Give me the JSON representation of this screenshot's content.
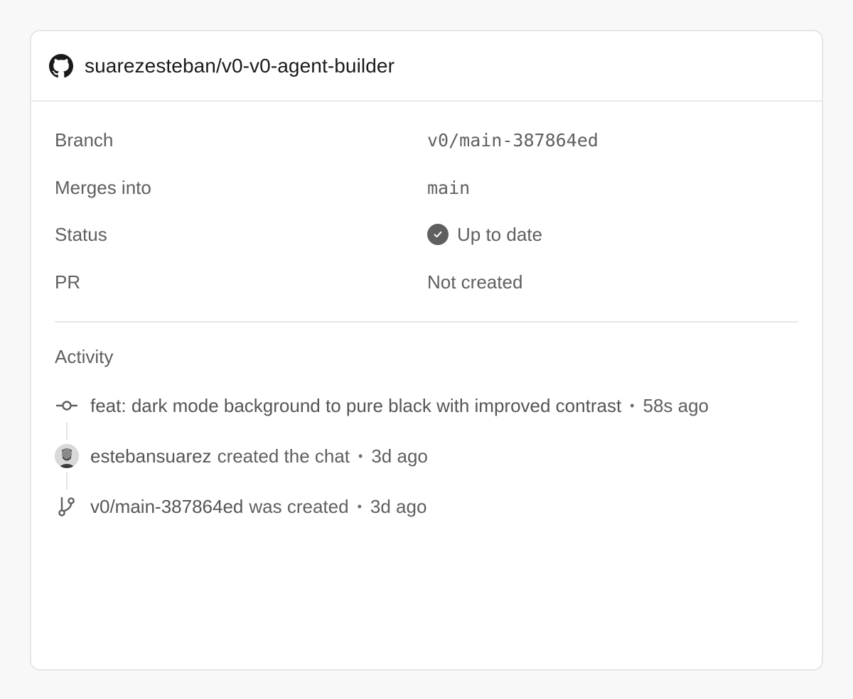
{
  "header": {
    "repo": "suarezesteban/v0-v0-agent-builder",
    "icon": "github-icon"
  },
  "details": {
    "branch": {
      "label": "Branch",
      "value": "v0/main-387864ed"
    },
    "merges_into": {
      "label": "Merges into",
      "value": "main"
    },
    "status": {
      "label": "Status",
      "value": "Up to date",
      "icon": "check-circle-icon"
    },
    "pr": {
      "label": "PR",
      "value": "Not created"
    }
  },
  "activity": {
    "title": "Activity",
    "items": [
      {
        "icon": "commit-icon",
        "subject": "feat: dark mode background to pure black with improved contrast",
        "text": "",
        "separator": "•",
        "time": "58s ago"
      },
      {
        "icon": "avatar",
        "subject": "estebansuarez",
        "text": "created the chat",
        "separator": "•",
        "time": "3d ago"
      },
      {
        "icon": "branch-icon",
        "subject": "v0/main-387864ed",
        "text": "was created",
        "separator": "•",
        "time": "3d ago"
      }
    ]
  },
  "colors": {
    "text_primary": "#1a1a1a",
    "text_secondary": "#5f5f5f",
    "border": "#e6e6e6",
    "background": "#f8f8f8",
    "card": "#ffffff"
  }
}
